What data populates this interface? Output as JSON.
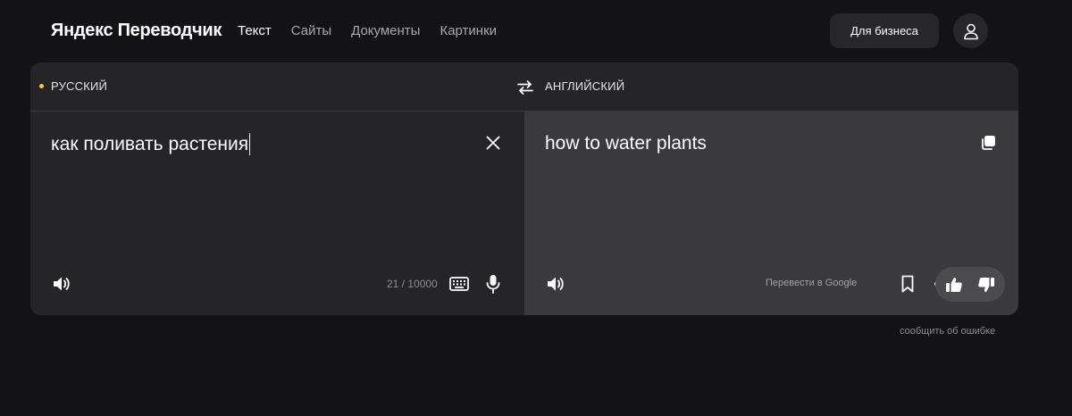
{
  "header": {
    "logo": "Яндекс Переводчик",
    "nav": [
      {
        "label": "Текст",
        "active": true
      },
      {
        "label": "Сайты",
        "active": false
      },
      {
        "label": "Документы",
        "active": false
      },
      {
        "label": "Картинки",
        "active": false
      }
    ],
    "business_button": "Для бизнеса",
    "user_icon": "user-icon"
  },
  "translator": {
    "source_lang": "РУССКИЙ",
    "target_lang": "АНГЛИЙСКИЙ",
    "source_text": "как поливать растения",
    "translated_text": "how to water plants",
    "char_counter": "21 / 10000",
    "google_link": "Перевести в Google"
  },
  "footer": {
    "report_error": "сообщить об ошибке"
  },
  "colors": {
    "background": "#131315",
    "card": "#252527",
    "target_pane": "#3a3a3e",
    "accent_dot": "#f5c84b"
  }
}
